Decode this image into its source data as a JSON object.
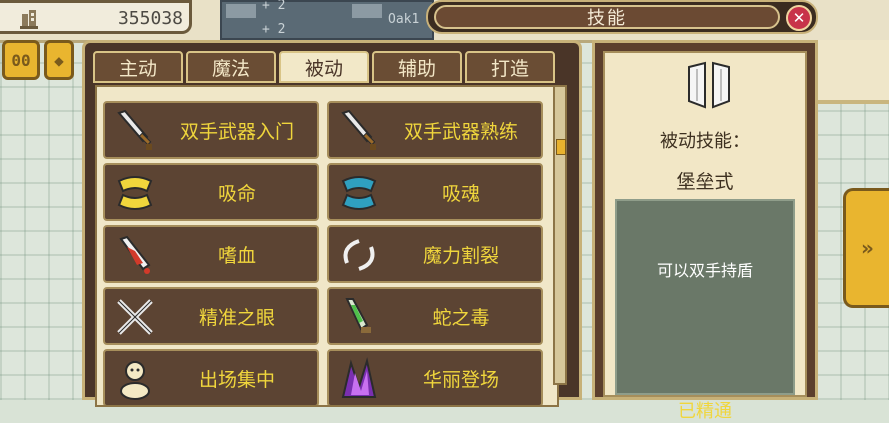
{
  "header": {
    "coins": "355038",
    "title": "技能",
    "close_label": "✕",
    "mini_text_1": "+ 2",
    "mini_text_2": "Oak1",
    "mini_text_3": "+ 2"
  },
  "side_buttons": {
    "left_1": "00",
    "left_2": "◆"
  },
  "tabs": [
    {
      "label": "主动"
    },
    {
      "label": "魔法"
    },
    {
      "label": "被动"
    },
    {
      "label": "辅助"
    },
    {
      "label": "打造"
    }
  ],
  "active_tab": "被动",
  "skills": [
    {
      "label": "双手武器入门",
      "icon": "sword-icon"
    },
    {
      "label": "双手武器熟练",
      "icon": "sword-icon"
    },
    {
      "label": "吸命",
      "icon": "jaw-icon"
    },
    {
      "label": "吸魂",
      "icon": "jaw-icon"
    },
    {
      "label": "嗜血",
      "icon": "blood-blade-icon"
    },
    {
      "label": "魔力割裂",
      "icon": "arc-icon"
    },
    {
      "label": "精准之眼",
      "icon": "cross-swords-icon"
    },
    {
      "label": "蛇之毒",
      "icon": "poison-dagger-icon"
    },
    {
      "label": "出场集中",
      "icon": "spirit-icon"
    },
    {
      "label": "华丽登场",
      "icon": "purple-flame-icon"
    }
  ],
  "detail": {
    "type_label": "被动技能：",
    "skill_name": "堡垒式",
    "description": "可以双手持盾",
    "status": "已精通"
  },
  "next_button": "»",
  "colors": {
    "panel_brown": "#4a3528",
    "gold_border": "#c7b178",
    "label_yellow": "#f0d63c",
    "accent_gold": "#e9b52f"
  }
}
